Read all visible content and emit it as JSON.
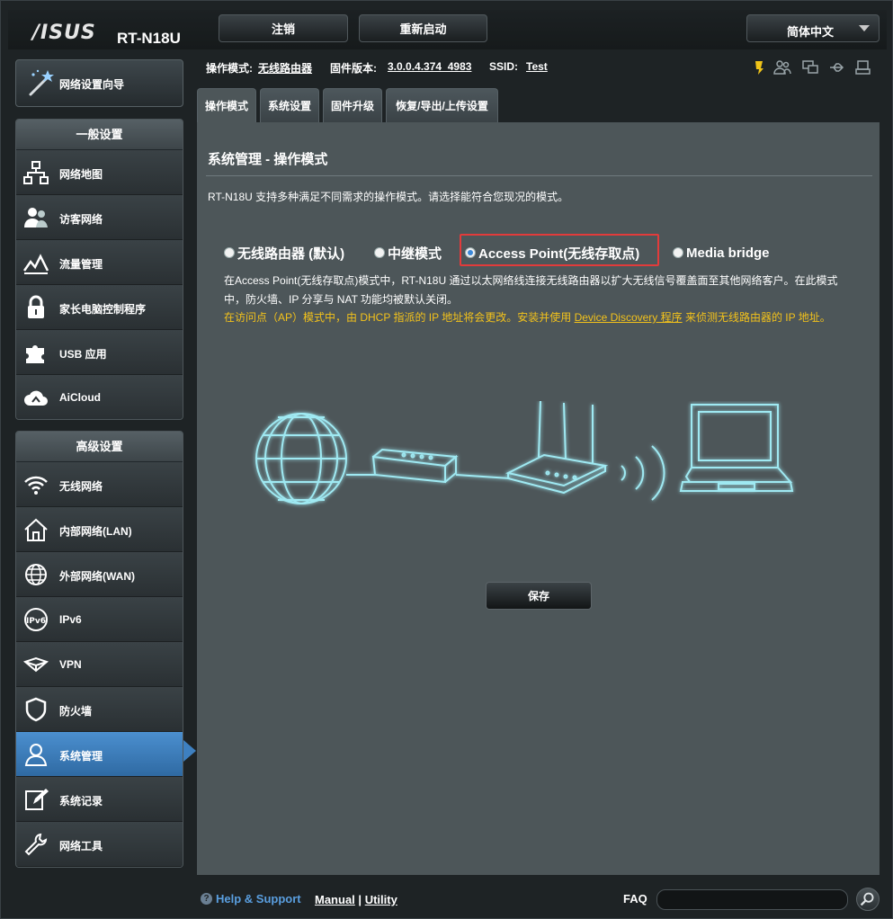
{
  "header": {
    "logo": "/ISUS",
    "model": "RT-N18U",
    "logout_label": "注销",
    "reboot_label": "重新启动",
    "language": "简体中文"
  },
  "sidebar": {
    "wizard_label": "网络设置向导",
    "general_title": "一般设置",
    "general_items": [
      {
        "label": "网络地图",
        "icon": "network-map-icon"
      },
      {
        "label": "访客网络",
        "icon": "guest-network-icon"
      },
      {
        "label": "流量管理",
        "icon": "traffic-manager-icon"
      },
      {
        "label": "家长电脑控制程序",
        "icon": "parental-control-icon"
      },
      {
        "label": "USB 应用",
        "icon": "usb-puzzle-icon"
      },
      {
        "label": "AiCloud",
        "icon": "aicloud-icon"
      }
    ],
    "advanced_title": "高级设置",
    "advanced_items": [
      {
        "label": "无线网络",
        "icon": "wireless-icon"
      },
      {
        "label": "内部网络(LAN)",
        "icon": "lan-house-icon"
      },
      {
        "label": "外部网络(WAN)",
        "icon": "wan-globe-icon"
      },
      {
        "label": "IPv6",
        "icon": "ipv6-icon"
      },
      {
        "label": "VPN",
        "icon": "vpn-icon"
      },
      {
        "label": "防火墙",
        "icon": "firewall-shield-icon"
      },
      {
        "label": "系统管理",
        "icon": "administration-user-icon"
      },
      {
        "label": "系统记录",
        "icon": "system-log-icon"
      },
      {
        "label": "网络工具",
        "icon": "network-tools-icon"
      }
    ]
  },
  "info": {
    "mode_label": "操作模式:",
    "mode_value": "无线路由器",
    "firmware_label": "固件版本:",
    "firmware_value": "3.0.0.4.374_4983",
    "ssid_label": "SSID:",
    "ssid_value": "Test"
  },
  "tabs": [
    "操作模式",
    "系统设置",
    "固件升级",
    "恢复/导出/上传设置"
  ],
  "main": {
    "title": "系统管理 - 操作模式",
    "description": "RT-N18U 支持多种满足不同需求的操作模式。请选择能符合您现况的模式。",
    "options": [
      "无线路由器 (默认)",
      "中继模式",
      "Access Point(无线存取点)",
      "Media bridge"
    ],
    "selected_option": "Access Point(无线存取点)",
    "mode_description": "在Access Point(无线存取点)模式中，RT-N18U 通过以太网络线连接无线路由器以扩大无线信号覆盖面至其他网络客户。在此模式中，防火墙、IP 分享与 NAT 功能均被默认关闭。",
    "note_prefix": "在访问点（AP）模式中，由 DHCP 指派的 IP 地址将会更改。安装并使用 ",
    "note_link": "Device Discovery 程序",
    "note_suffix": " 来侦测无线路由器的 IP 地址。",
    "save_label": "保存",
    "accent_color": "#f3c21b",
    "highlight_color": "#e23b3b"
  },
  "footer": {
    "help_label": "Help & Support",
    "manual_label": "Manual",
    "separator": "|",
    "utility_label": "Utility",
    "faq_label": "FAQ",
    "faq_value": ""
  }
}
